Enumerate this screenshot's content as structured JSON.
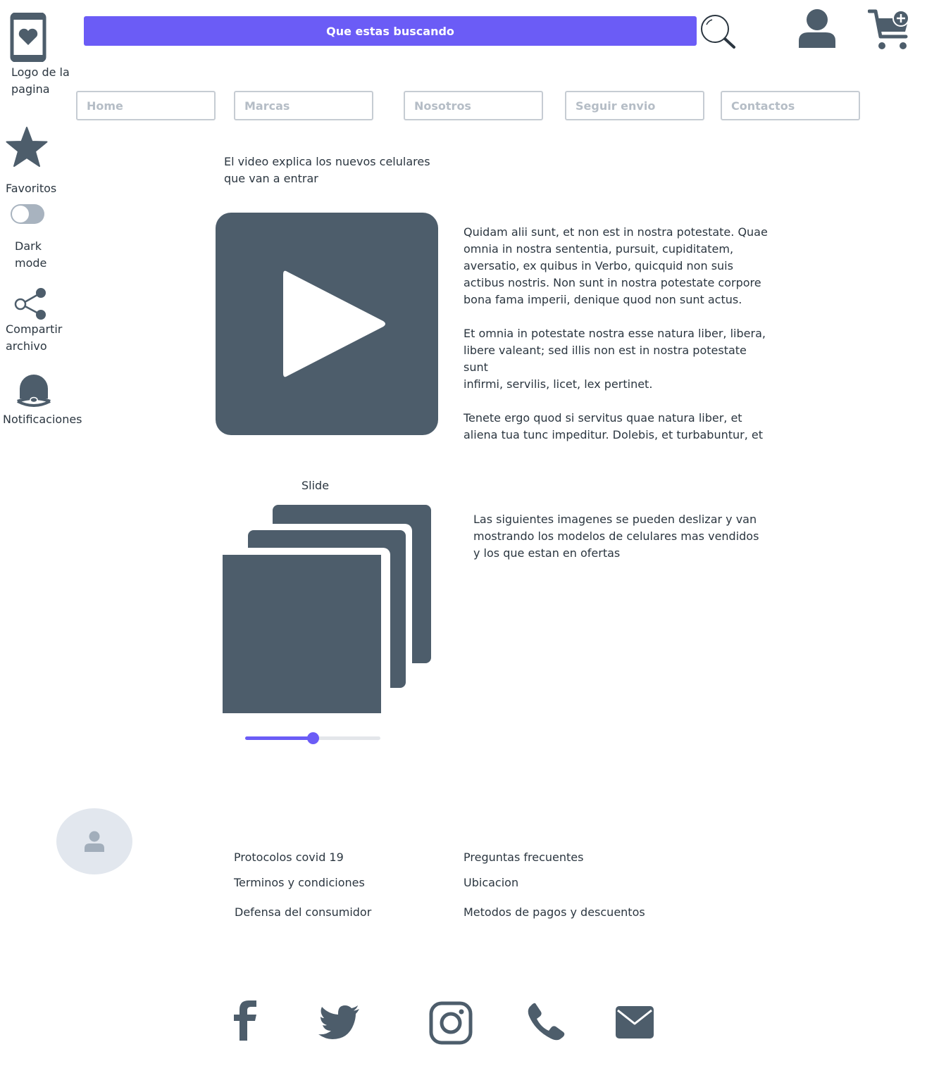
{
  "header": {
    "logo_label_line1": "Logo de la",
    "logo_label_line2": "pagina",
    "search_label": "Que estas buscando"
  },
  "nav": {
    "items": [
      {
        "label": "Home"
      },
      {
        "label": "Marcas"
      },
      {
        "label": "Nosotros"
      },
      {
        "label": "Seguir envio"
      },
      {
        "label": "Contactos"
      }
    ]
  },
  "sidebar": {
    "favoritos": "Favoritos",
    "dark_mode_line1": "Dark",
    "dark_mode_line2": "mode",
    "dark_mode_on": false,
    "compartir_line1": "Compartir",
    "compartir_line2": "archivo",
    "notificaciones": "Notificaciones"
  },
  "video_section": {
    "caption_line1": "El video explica los nuevos celulares",
    "caption_line2": "que van a entrar",
    "paragraph1": [
      "Quidam alii sunt, et non est in nostra potestate. Quae",
      "omnia in nostra sententia, pursuit, cupiditatem,",
      "aversatio, ex quibus in Verbo, quicquid non suis",
      "actibus nostris. Non sunt in nostra potestate corpore",
      "bona fama imperii, denique quod non sunt actus."
    ],
    "paragraph2": [
      "Et omnia in potestate nostra esse natura liber, libera,",
      "libere valeant; sed illis non est in nostra potestate sunt",
      "infirmi, servilis, licet, lex pertinet."
    ],
    "paragraph3": [
      "Tenete ergo quod si servitus quae natura liber, et",
      "aliena tua tunc impeditur. Dolebis, et turbabuntur, et"
    ]
  },
  "slide_section": {
    "title": "Slide",
    "description": [
      "Las siguientes imagenes se pueden deslizar y van",
      "mostrando los modelos de celulares mas vendidos",
      "y los que estan en ofertas"
    ],
    "slider_value": 0.5
  },
  "footer": {
    "links_col1": [
      "Protocolos covid 19",
      "Terminos y condiciones",
      "Defensa del consumidor"
    ],
    "links_col2": [
      "Preguntas frecuentes",
      "Ubicacion",
      "Metodos de pagos y descuentos"
    ],
    "social_icons": [
      "facebook-icon",
      "twitter-icon",
      "instagram-icon",
      "phone-icon",
      "mail-icon"
    ]
  },
  "colors": {
    "accent": "#6b5cf6",
    "icon": "#4d5d6b",
    "text": "#2b3640",
    "nav_border": "#c6ccd3",
    "nav_text": "#b5bdc6"
  }
}
